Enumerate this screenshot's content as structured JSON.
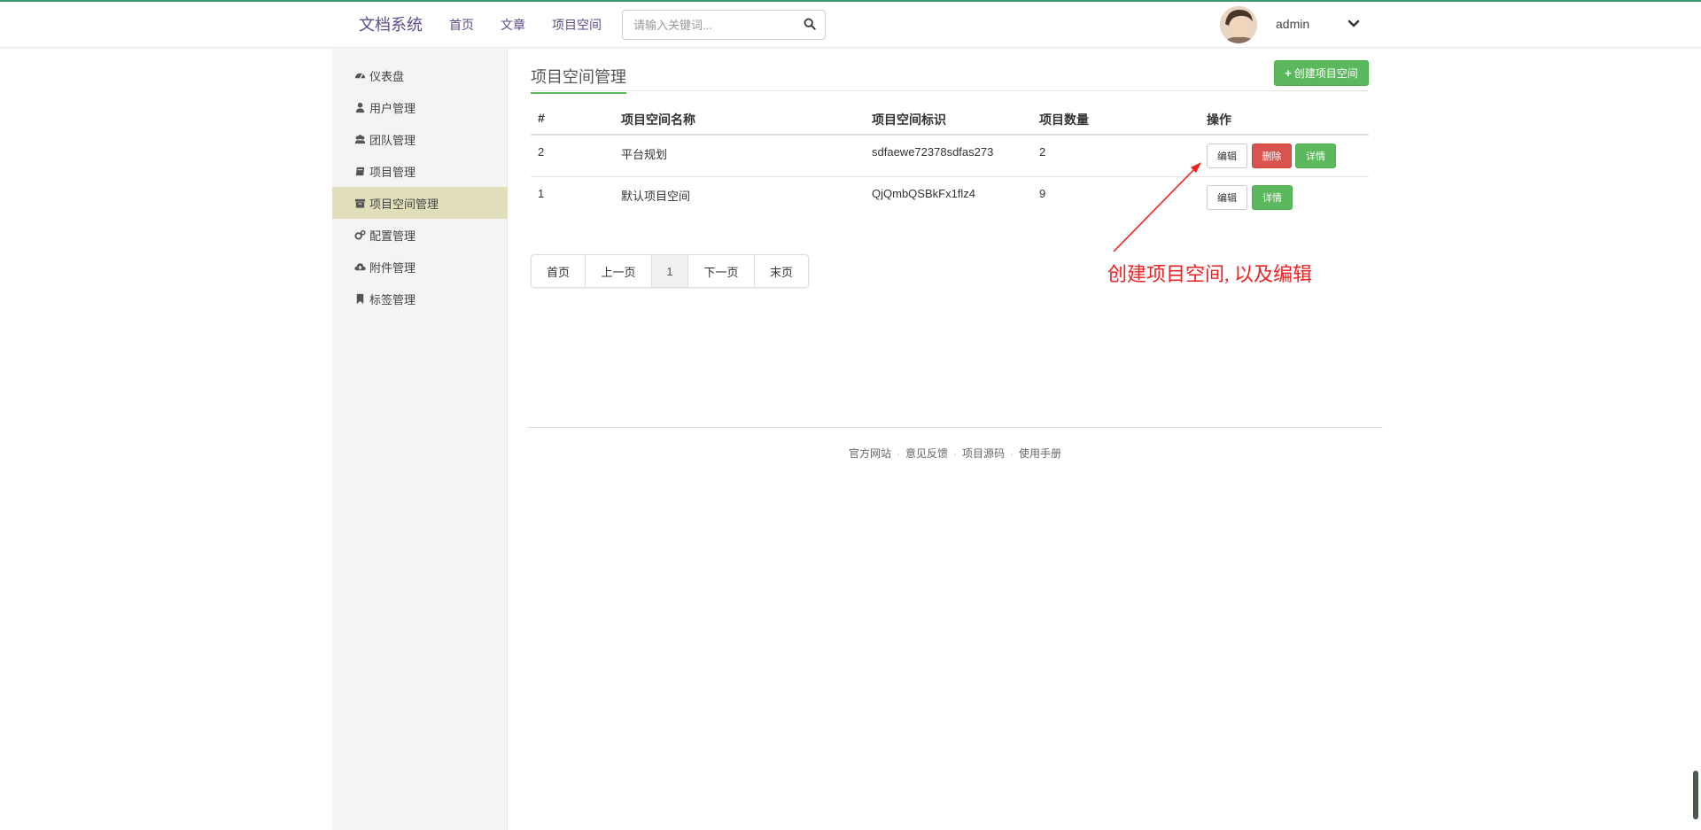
{
  "navbar": {
    "brand": "文档系统",
    "links": [
      "首页",
      "文章",
      "项目空间"
    ],
    "search_placeholder": "请输入关键词...",
    "username": "admin"
  },
  "sidebar": {
    "items": [
      {
        "label": "仪表盘",
        "icon": "dashboard-icon"
      },
      {
        "label": "用户管理",
        "icon": "user-icon"
      },
      {
        "label": "团队管理",
        "icon": "users-icon"
      },
      {
        "label": "项目管理",
        "icon": "book-icon"
      },
      {
        "label": "项目空间管理",
        "icon": "archive-icon",
        "active": true
      },
      {
        "label": "配置管理",
        "icon": "cogs-icon"
      },
      {
        "label": "附件管理",
        "icon": "cloud-upload-icon"
      },
      {
        "label": "标签管理",
        "icon": "bookmark-icon"
      }
    ]
  },
  "main": {
    "title": "项目空间管理",
    "create_button": "创建项目空间",
    "table": {
      "headers": [
        "#",
        "项目空间名称",
        "项目空间标识",
        "项目数量",
        "操作"
      ],
      "rows": [
        {
          "id": "2",
          "name": "平台规划",
          "identifier": "sdfaewe72378sdfas273",
          "count": "2",
          "actions": [
            "编辑",
            "删除",
            "详情"
          ]
        },
        {
          "id": "1",
          "name": "默认项目空间",
          "identifier": "QjQmbQSBkFx1flz4",
          "count": "9",
          "actions": [
            "编辑",
            "详情"
          ]
        }
      ]
    },
    "pagination": [
      "首页",
      "上一页",
      "1",
      "下一页",
      "末页"
    ],
    "annotation": "创建项目空间, 以及编辑"
  },
  "footer": {
    "links": [
      "官方网站",
      "意见反馈",
      "项目源码",
      "使用手册"
    ],
    "separator": "·"
  },
  "colors": {
    "accent_green": "#5cb85c",
    "danger_red": "#d9534f",
    "sidebar_active": "#e0dfba",
    "brand_purple": "#5e4b8b",
    "annotation_red": "#ee2222"
  }
}
